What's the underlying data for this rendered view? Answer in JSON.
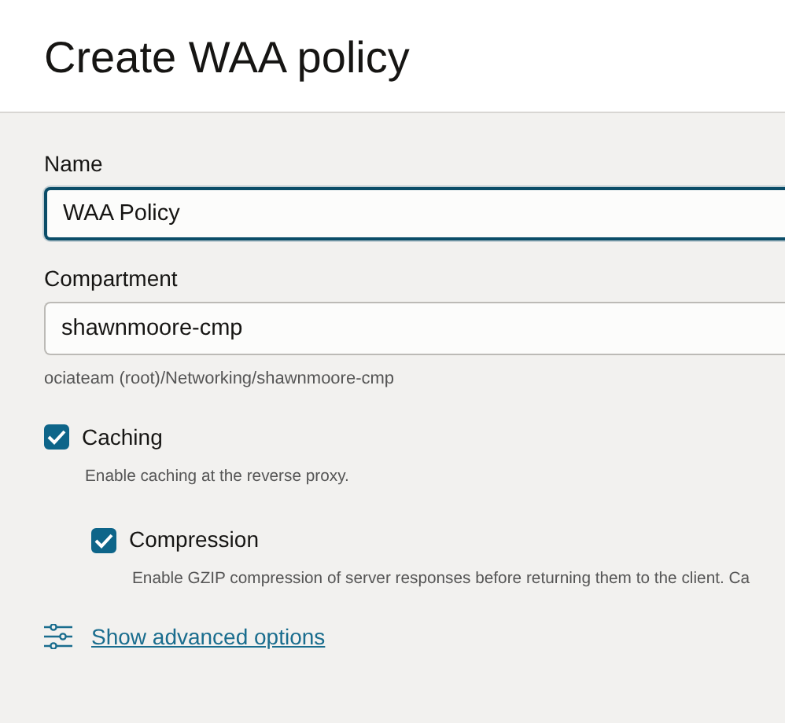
{
  "header": {
    "title": "Create WAA policy"
  },
  "fields": [
    {
      "label": "Name",
      "value": "WAA Policy",
      "focused": true
    },
    {
      "label": "Compartment",
      "value": "shawnmoore-cmp",
      "focused": false,
      "hint": "ociateam (root)/Networking/shawnmoore-cmp"
    }
  ],
  "options": [
    {
      "label": "Caching",
      "checked": true,
      "description": "Enable caching at the reverse proxy.",
      "children": [
        {
          "label": "Compression",
          "checked": true,
          "description": "Enable GZIP compression of server responses before returning them to the client. Ca"
        }
      ]
    }
  ],
  "advanced_link": "Show advanced options"
}
